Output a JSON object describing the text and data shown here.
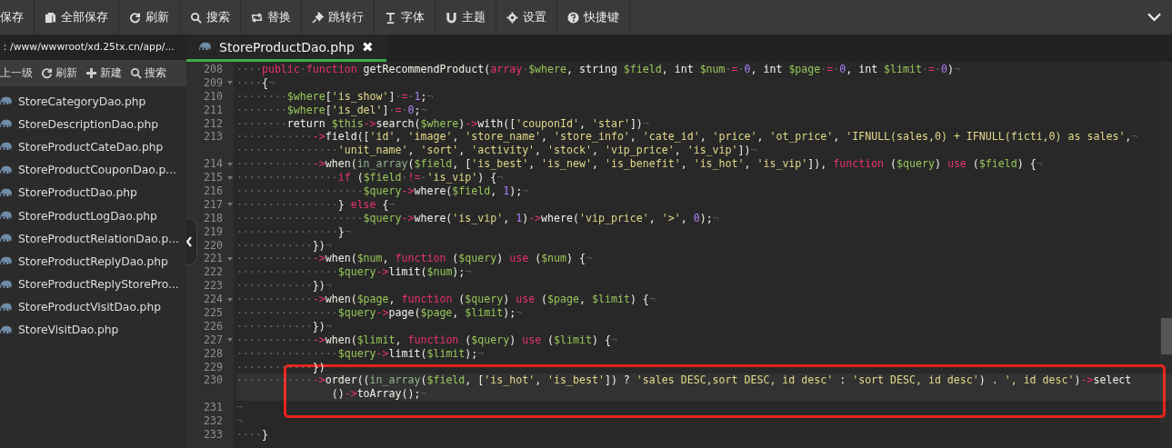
{
  "toolbar": {
    "items": [
      {
        "label": "保存"
      },
      {
        "label": "全部保存"
      },
      {
        "label": "刷新"
      },
      {
        "label": "搜索"
      },
      {
        "label": "替换"
      },
      {
        "label": "跳转行"
      },
      {
        "label": "字体"
      },
      {
        "label": "主题"
      },
      {
        "label": "设置"
      },
      {
        "label": "快捷键"
      }
    ]
  },
  "sidebar": {
    "path": "：/www/wwwroot/xd.25tx.cn/app/...",
    "tools": [
      {
        "label": "上一级"
      },
      {
        "label": "刷新"
      },
      {
        "label": "新建"
      },
      {
        "label": "搜索"
      }
    ],
    "files": [
      {
        "name": "StoreCategoryDao.php"
      },
      {
        "name": "StoreDescriptionDao.php"
      },
      {
        "name": "StoreProductCateDao.php"
      },
      {
        "name": "StoreProductCouponDao.p..."
      },
      {
        "name": "StoreProductDao.php"
      },
      {
        "name": "StoreProductLogDao.php"
      },
      {
        "name": "StoreProductRelationDao.p..."
      },
      {
        "name": "StoreProductReplyDao.php"
      },
      {
        "name": "StoreProductReplyStorePro..."
      },
      {
        "name": "StoreProductVisitDao.php"
      },
      {
        "name": "StoreVisitDao.php"
      }
    ]
  },
  "editor": {
    "tabs": [
      {
        "label": "StoreProductDao.php",
        "close": "✖",
        "selected": true
      }
    ],
    "lines": [
      {
        "number": "208",
        "foldable": false,
        "current": false,
        "rows": [
          {
            "tokens": [
              {
                "kind": "w",
                "text": "····"
              },
              {
                "kind": "k",
                "text": "public"
              },
              {
                "kind": "w",
                "text": "·"
              },
              {
                "kind": "k",
                "text": "function"
              },
              {
                "kind": "p",
                "text": " getRecommendProduct("
              },
              {
                "kind": "k",
                "text": "array"
              },
              {
                "kind": "w",
                "text": "·"
              },
              {
                "kind": "v",
                "text": "$where"
              },
              {
                "kind": "p",
                "text": ", string "
              },
              {
                "kind": "v",
                "text": "$field"
              },
              {
                "kind": "p",
                "text": ", int "
              },
              {
                "kind": "v",
                "text": "$num"
              },
              {
                "kind": "w",
                "text": "·"
              },
              {
                "kind": "o",
                "text": "="
              },
              {
                "kind": "w",
                "text": "·"
              },
              {
                "kind": "n",
                "text": "0"
              },
              {
                "kind": "p",
                "text": ", int "
              },
              {
                "kind": "v",
                "text": "$page"
              },
              {
                "kind": "w",
                "text": "·"
              },
              {
                "kind": "o",
                "text": "="
              },
              {
                "kind": "w",
                "text": "·"
              },
              {
                "kind": "n",
                "text": "0"
              },
              {
                "kind": "p",
                "text": ", int "
              },
              {
                "kind": "v",
                "text": "$limit"
              },
              {
                "kind": "w",
                "text": "·"
              },
              {
                "kind": "o",
                "text": "="
              },
              {
                "kind": "w",
                "text": "·"
              },
              {
                "kind": "n",
                "text": "0"
              },
              {
                "kind": "p",
                "text": ")"
              },
              {
                "kind": "e",
                "text": "¬"
              }
            ]
          }
        ]
      },
      {
        "number": "209",
        "foldable": true,
        "current": false,
        "rows": [
          {
            "tokens": [
              {
                "kind": "w",
                "text": "····"
              },
              {
                "kind": "p",
                "text": "{"
              },
              {
                "kind": "e",
                "text": "¬"
              }
            ]
          }
        ]
      },
      {
        "number": "210",
        "foldable": false,
        "current": false,
        "rows": [
          {
            "tokens": [
              {
                "kind": "w",
                "text": "········"
              },
              {
                "kind": "v",
                "text": "$where"
              },
              {
                "kind": "p",
                "text": "["
              },
              {
                "kind": "s",
                "text": "'is_show'"
              },
              {
                "kind": "p",
                "text": "]"
              },
              {
                "kind": "w",
                "text": "·"
              },
              {
                "kind": "o",
                "text": "="
              },
              {
                "kind": "w",
                "text": "·"
              },
              {
                "kind": "n",
                "text": "1"
              },
              {
                "kind": "p",
                "text": ";"
              },
              {
                "kind": "e",
                "text": "¬"
              }
            ]
          }
        ]
      },
      {
        "number": "211",
        "foldable": false,
        "current": false,
        "rows": [
          {
            "tokens": [
              {
                "kind": "w",
                "text": "········"
              },
              {
                "kind": "v",
                "text": "$where"
              },
              {
                "kind": "p",
                "text": "["
              },
              {
                "kind": "s",
                "text": "'is_del'"
              },
              {
                "kind": "p",
                "text": "]"
              },
              {
                "kind": "w",
                "text": "·"
              },
              {
                "kind": "o",
                "text": "="
              },
              {
                "kind": "w",
                "text": "·"
              },
              {
                "kind": "n",
                "text": "0"
              },
              {
                "kind": "p",
                "text": ";"
              },
              {
                "kind": "e",
                "text": "¬"
              }
            ]
          }
        ]
      },
      {
        "number": "212",
        "foldable": false,
        "current": false,
        "rows": [
          {
            "tokens": [
              {
                "kind": "w",
                "text": "········"
              },
              {
                "kind": "p",
                "text": "return "
              },
              {
                "kind": "v",
                "text": "$this"
              },
              {
                "kind": "o",
                "text": "->"
              },
              {
                "kind": "p",
                "text": "search("
              },
              {
                "kind": "v",
                "text": "$where"
              },
              {
                "kind": "p",
                "text": ")"
              },
              {
                "kind": "o",
                "text": "->"
              },
              {
                "kind": "p",
                "text": "with(["
              },
              {
                "kind": "s",
                "text": "'couponId'"
              },
              {
                "kind": "p",
                "text": ", "
              },
              {
                "kind": "s",
                "text": "'star'"
              },
              {
                "kind": "p",
                "text": "])"
              },
              {
                "kind": "e",
                "text": "¬"
              }
            ]
          }
        ]
      },
      {
        "number": "213",
        "foldable": false,
        "current": false,
        "rows": [
          {
            "tokens": [
              {
                "kind": "w",
                "text": "············"
              },
              {
                "kind": "o",
                "text": "->"
              },
              {
                "kind": "p",
                "text": "field(["
              },
              {
                "kind": "s",
                "text": "'id'"
              },
              {
                "kind": "p",
                "text": ", "
              },
              {
                "kind": "s",
                "text": "'image'"
              },
              {
                "kind": "p",
                "text": ", "
              },
              {
                "kind": "s",
                "text": "'store_name'"
              },
              {
                "kind": "p",
                "text": ", "
              },
              {
                "kind": "s",
                "text": "'store_info'"
              },
              {
                "kind": "p",
                "text": ", "
              },
              {
                "kind": "s",
                "text": "'cate_id'"
              },
              {
                "kind": "p",
                "text": ", "
              },
              {
                "kind": "s",
                "text": "'price'"
              },
              {
                "kind": "p",
                "text": ", "
              },
              {
                "kind": "s",
                "text": "'ot_price'"
              },
              {
                "kind": "p",
                "text": ", "
              },
              {
                "kind": "s",
                "text": "'IFNULL(sales,0) + IFNULL(ficti,0) as sales'"
              },
              {
                "kind": "p",
                "text": ","
              },
              {
                "kind": "e",
                "text": "¬"
              }
            ]
          },
          {
            "tokens": [
              {
                "kind": "w",
                "text": "················"
              },
              {
                "kind": "s",
                "text": "'unit_name'"
              },
              {
                "kind": "p",
                "text": ", "
              },
              {
                "kind": "s",
                "text": "'sort'"
              },
              {
                "kind": "p",
                "text": ", "
              },
              {
                "kind": "s",
                "text": "'activity'"
              },
              {
                "kind": "p",
                "text": ", "
              },
              {
                "kind": "s",
                "text": "'stock'"
              },
              {
                "kind": "p",
                "text": ", "
              },
              {
                "kind": "s",
                "text": "'vip_price'"
              },
              {
                "kind": "p",
                "text": ", "
              },
              {
                "kind": "s",
                "text": "'is_vip'"
              },
              {
                "kind": "p",
                "text": "])"
              },
              {
                "kind": "e",
                "text": "¬"
              }
            ]
          }
        ]
      },
      {
        "number": "214",
        "foldable": true,
        "current": false,
        "rows": [
          {
            "tokens": [
              {
                "kind": "w",
                "text": "············"
              },
              {
                "kind": "o",
                "text": "->"
              },
              {
                "kind": "p",
                "text": "when("
              },
              {
                "kind": "f",
                "text": "in_array"
              },
              {
                "kind": "p",
                "text": "("
              },
              {
                "kind": "v",
                "text": "$field"
              },
              {
                "kind": "p",
                "text": ", ["
              },
              {
                "kind": "s",
                "text": "'is_best'"
              },
              {
                "kind": "p",
                "text": ", "
              },
              {
                "kind": "s",
                "text": "'is_new'"
              },
              {
                "kind": "p",
                "text": ", "
              },
              {
                "kind": "s",
                "text": "'is_benefit'"
              },
              {
                "kind": "p",
                "text": ", "
              },
              {
                "kind": "s",
                "text": "'is_hot'"
              },
              {
                "kind": "p",
                "text": ", "
              },
              {
                "kind": "s",
                "text": "'is_vip'"
              },
              {
                "kind": "p",
                "text": "]), "
              },
              {
                "kind": "k",
                "text": "function"
              },
              {
                "kind": "p",
                "text": " ("
              },
              {
                "kind": "v",
                "text": "$query"
              },
              {
                "kind": "p",
                "text": ") "
              },
              {
                "kind": "k",
                "text": "use"
              },
              {
                "kind": "p",
                "text": " ("
              },
              {
                "kind": "v",
                "text": "$field"
              },
              {
                "kind": "p",
                "text": ") {"
              },
              {
                "kind": "e",
                "text": "¬"
              }
            ]
          }
        ]
      },
      {
        "number": "215",
        "foldable": true,
        "current": false,
        "rows": [
          {
            "tokens": [
              {
                "kind": "w",
                "text": "················"
              },
              {
                "kind": "k",
                "text": "if"
              },
              {
                "kind": "p",
                "text": " ("
              },
              {
                "kind": "v",
                "text": "$field"
              },
              {
                "kind": "w",
                "text": "·"
              },
              {
                "kind": "o",
                "text": "!="
              },
              {
                "kind": "w",
                "text": "·"
              },
              {
                "kind": "s",
                "text": "'is_vip'"
              },
              {
                "kind": "p",
                "text": ") {"
              },
              {
                "kind": "e",
                "text": "¬"
              }
            ]
          }
        ]
      },
      {
        "number": "216",
        "foldable": false,
        "current": false,
        "rows": [
          {
            "tokens": [
              {
                "kind": "w",
                "text": "····················"
              },
              {
                "kind": "v",
                "text": "$query"
              },
              {
                "kind": "o",
                "text": "->"
              },
              {
                "kind": "p",
                "text": "where("
              },
              {
                "kind": "v",
                "text": "$field"
              },
              {
                "kind": "p",
                "text": ", "
              },
              {
                "kind": "n",
                "text": "1"
              },
              {
                "kind": "p",
                "text": ");"
              },
              {
                "kind": "e",
                "text": "¬"
              }
            ]
          }
        ]
      },
      {
        "number": "217",
        "foldable": true,
        "current": false,
        "rows": [
          {
            "tokens": [
              {
                "kind": "w",
                "text": "················"
              },
              {
                "kind": "p",
                "text": "} "
              },
              {
                "kind": "k",
                "text": "else"
              },
              {
                "kind": "p",
                "text": " {"
              },
              {
                "kind": "e",
                "text": "¬"
              }
            ]
          }
        ]
      },
      {
        "number": "218",
        "foldable": false,
        "current": false,
        "rows": [
          {
            "tokens": [
              {
                "kind": "w",
                "text": "····················"
              },
              {
                "kind": "v",
                "text": "$query"
              },
              {
                "kind": "o",
                "text": "->"
              },
              {
                "kind": "p",
                "text": "where("
              },
              {
                "kind": "s",
                "text": "'is_vip'"
              },
              {
                "kind": "p",
                "text": ", "
              },
              {
                "kind": "n",
                "text": "1"
              },
              {
                "kind": "p",
                "text": ")"
              },
              {
                "kind": "o",
                "text": "->"
              },
              {
                "kind": "p",
                "text": "where("
              },
              {
                "kind": "s",
                "text": "'vip_price'"
              },
              {
                "kind": "p",
                "text": ", "
              },
              {
                "kind": "s",
                "text": "'>'"
              },
              {
                "kind": "p",
                "text": ", "
              },
              {
                "kind": "n",
                "text": "0"
              },
              {
                "kind": "p",
                "text": ");"
              },
              {
                "kind": "e",
                "text": "¬"
              }
            ]
          }
        ]
      },
      {
        "number": "219",
        "foldable": false,
        "current": false,
        "rows": [
          {
            "tokens": [
              {
                "kind": "w",
                "text": "················"
              },
              {
                "kind": "p",
                "text": "}"
              },
              {
                "kind": "e",
                "text": "¬"
              }
            ]
          }
        ]
      },
      {
        "number": "220",
        "foldable": false,
        "current": false,
        "rows": [
          {
            "tokens": [
              {
                "kind": "w",
                "text": "············"
              },
              {
                "kind": "p",
                "text": "})"
              },
              {
                "kind": "e",
                "text": "¬"
              }
            ]
          }
        ]
      },
      {
        "number": "221",
        "foldable": true,
        "current": false,
        "rows": [
          {
            "tokens": [
              {
                "kind": "w",
                "text": "············"
              },
              {
                "kind": "o",
                "text": "->"
              },
              {
                "kind": "p",
                "text": "when("
              },
              {
                "kind": "v",
                "text": "$num"
              },
              {
                "kind": "p",
                "text": ", "
              },
              {
                "kind": "k",
                "text": "function"
              },
              {
                "kind": "p",
                "text": " ("
              },
              {
                "kind": "v",
                "text": "$query"
              },
              {
                "kind": "p",
                "text": ") "
              },
              {
                "kind": "k",
                "text": "use"
              },
              {
                "kind": "p",
                "text": " ("
              },
              {
                "kind": "v",
                "text": "$num"
              },
              {
                "kind": "p",
                "text": ") {"
              },
              {
                "kind": "e",
                "text": "¬"
              }
            ]
          }
        ]
      },
      {
        "number": "222",
        "foldable": false,
        "current": false,
        "rows": [
          {
            "tokens": [
              {
                "kind": "w",
                "text": "················"
              },
              {
                "kind": "v",
                "text": "$query"
              },
              {
                "kind": "o",
                "text": "->"
              },
              {
                "kind": "p",
                "text": "limit("
              },
              {
                "kind": "v",
                "text": "$num"
              },
              {
                "kind": "p",
                "text": ");"
              },
              {
                "kind": "e",
                "text": "¬"
              }
            ]
          }
        ]
      },
      {
        "number": "223",
        "foldable": false,
        "current": false,
        "rows": [
          {
            "tokens": [
              {
                "kind": "w",
                "text": "············"
              },
              {
                "kind": "p",
                "text": "})"
              },
              {
                "kind": "e",
                "text": "¬"
              }
            ]
          }
        ]
      },
      {
        "number": "224",
        "foldable": true,
        "current": false,
        "rows": [
          {
            "tokens": [
              {
                "kind": "w",
                "text": "············"
              },
              {
                "kind": "o",
                "text": "->"
              },
              {
                "kind": "p",
                "text": "when("
              },
              {
                "kind": "v",
                "text": "$page"
              },
              {
                "kind": "p",
                "text": ", "
              },
              {
                "kind": "k",
                "text": "function"
              },
              {
                "kind": "p",
                "text": " ("
              },
              {
                "kind": "v",
                "text": "$query"
              },
              {
                "kind": "p",
                "text": ") "
              },
              {
                "kind": "k",
                "text": "use"
              },
              {
                "kind": "p",
                "text": " ("
              },
              {
                "kind": "v",
                "text": "$page"
              },
              {
                "kind": "p",
                "text": ", "
              },
              {
                "kind": "v",
                "text": "$limit"
              },
              {
                "kind": "p",
                "text": ") {"
              },
              {
                "kind": "e",
                "text": "¬"
              }
            ]
          }
        ]
      },
      {
        "number": "225",
        "foldable": false,
        "current": false,
        "rows": [
          {
            "tokens": [
              {
                "kind": "w",
                "text": "················"
              },
              {
                "kind": "v",
                "text": "$query"
              },
              {
                "kind": "o",
                "text": "->"
              },
              {
                "kind": "p",
                "text": "page("
              },
              {
                "kind": "v",
                "text": "$page"
              },
              {
                "kind": "p",
                "text": ", "
              },
              {
                "kind": "v",
                "text": "$limit"
              },
              {
                "kind": "p",
                "text": ");"
              },
              {
                "kind": "e",
                "text": "¬"
              }
            ]
          }
        ]
      },
      {
        "number": "226",
        "foldable": false,
        "current": false,
        "rows": [
          {
            "tokens": [
              {
                "kind": "w",
                "text": "············"
              },
              {
                "kind": "p",
                "text": "})"
              },
              {
                "kind": "e",
                "text": "¬"
              }
            ]
          }
        ]
      },
      {
        "number": "227",
        "foldable": true,
        "current": false,
        "rows": [
          {
            "tokens": [
              {
                "kind": "w",
                "text": "············"
              },
              {
                "kind": "o",
                "text": "->"
              },
              {
                "kind": "p",
                "text": "when("
              },
              {
                "kind": "v",
                "text": "$limit"
              },
              {
                "kind": "p",
                "text": ", "
              },
              {
                "kind": "k",
                "text": "function"
              },
              {
                "kind": "p",
                "text": " ("
              },
              {
                "kind": "v",
                "text": "$query"
              },
              {
                "kind": "p",
                "text": ") "
              },
              {
                "kind": "k",
                "text": "use"
              },
              {
                "kind": "p",
                "text": " ("
              },
              {
                "kind": "v",
                "text": "$limit"
              },
              {
                "kind": "p",
                "text": ") {"
              },
              {
                "kind": "e",
                "text": "¬"
              }
            ]
          }
        ]
      },
      {
        "number": "228",
        "foldable": false,
        "current": false,
        "rows": [
          {
            "tokens": [
              {
                "kind": "w",
                "text": "················"
              },
              {
                "kind": "v",
                "text": "$query"
              },
              {
                "kind": "o",
                "text": "->"
              },
              {
                "kind": "p",
                "text": "limit("
              },
              {
                "kind": "v",
                "text": "$limit"
              },
              {
                "kind": "p",
                "text": ");"
              },
              {
                "kind": "e",
                "text": "¬"
              }
            ]
          }
        ]
      },
      {
        "number": "229",
        "foldable": false,
        "current": false,
        "rows": [
          {
            "tokens": [
              {
                "kind": "w",
                "text": "············"
              },
              {
                "kind": "p",
                "text": "})"
              }
            ]
          }
        ]
      },
      {
        "number": "230",
        "foldable": false,
        "current": true,
        "rows": [
          {
            "tokens": [
              {
                "kind": "w",
                "text": "············"
              },
              {
                "kind": "o",
                "text": "->"
              },
              {
                "kind": "p",
                "text": "order(("
              },
              {
                "kind": "f",
                "text": "in_array"
              },
              {
                "kind": "p",
                "text": "("
              },
              {
                "kind": "v",
                "text": "$field"
              },
              {
                "kind": "p",
                "text": ", ["
              },
              {
                "kind": "s",
                "text": "'is_hot'"
              },
              {
                "kind": "p",
                "text": ", "
              },
              {
                "kind": "s",
                "text": "'is_best'"
              },
              {
                "kind": "p",
                "text": "]) ? "
              },
              {
                "kind": "s",
                "text": "'sales DESC,sort DESC, id desc'"
              },
              {
                "kind": "p",
                "text": " : "
              },
              {
                "kind": "s",
                "text": "'sort DESC, id desc'"
              },
              {
                "kind": "p",
                "text": ") . "
              },
              {
                "kind": "s",
                "text": "', id desc'"
              },
              {
                "kind": "p",
                "text": ")"
              },
              {
                "kind": "o",
                "text": "->"
              },
              {
                "kind": "p",
                "text": "select"
              }
            ]
          },
          {
            "tokens": [
              {
                "kind": "p",
                "text": "               ()"
              },
              {
                "kind": "o",
                "text": "->"
              },
              {
                "kind": "p",
                "text": "toArray();"
              },
              {
                "kind": "e",
                "text": "¬"
              }
            ]
          }
        ]
      },
      {
        "number": "231",
        "foldable": false,
        "current": false,
        "rows": [
          {
            "tokens": [
              {
                "kind": "e",
                "text": "¬"
              }
            ]
          }
        ]
      },
      {
        "number": "232",
        "foldable": false,
        "current": false,
        "rows": [
          {
            "tokens": [
              {
                "kind": "e",
                "text": "¬"
              }
            ]
          }
        ]
      },
      {
        "number": "233",
        "foldable": false,
        "current": false,
        "rows": [
          {
            "tokens": [
              {
                "kind": "w",
                "text": "····"
              },
              {
                "kind": "p",
                "text": "}"
              }
            ]
          }
        ]
      }
    ]
  },
  "annotation": {
    "kind": "rectangle"
  }
}
